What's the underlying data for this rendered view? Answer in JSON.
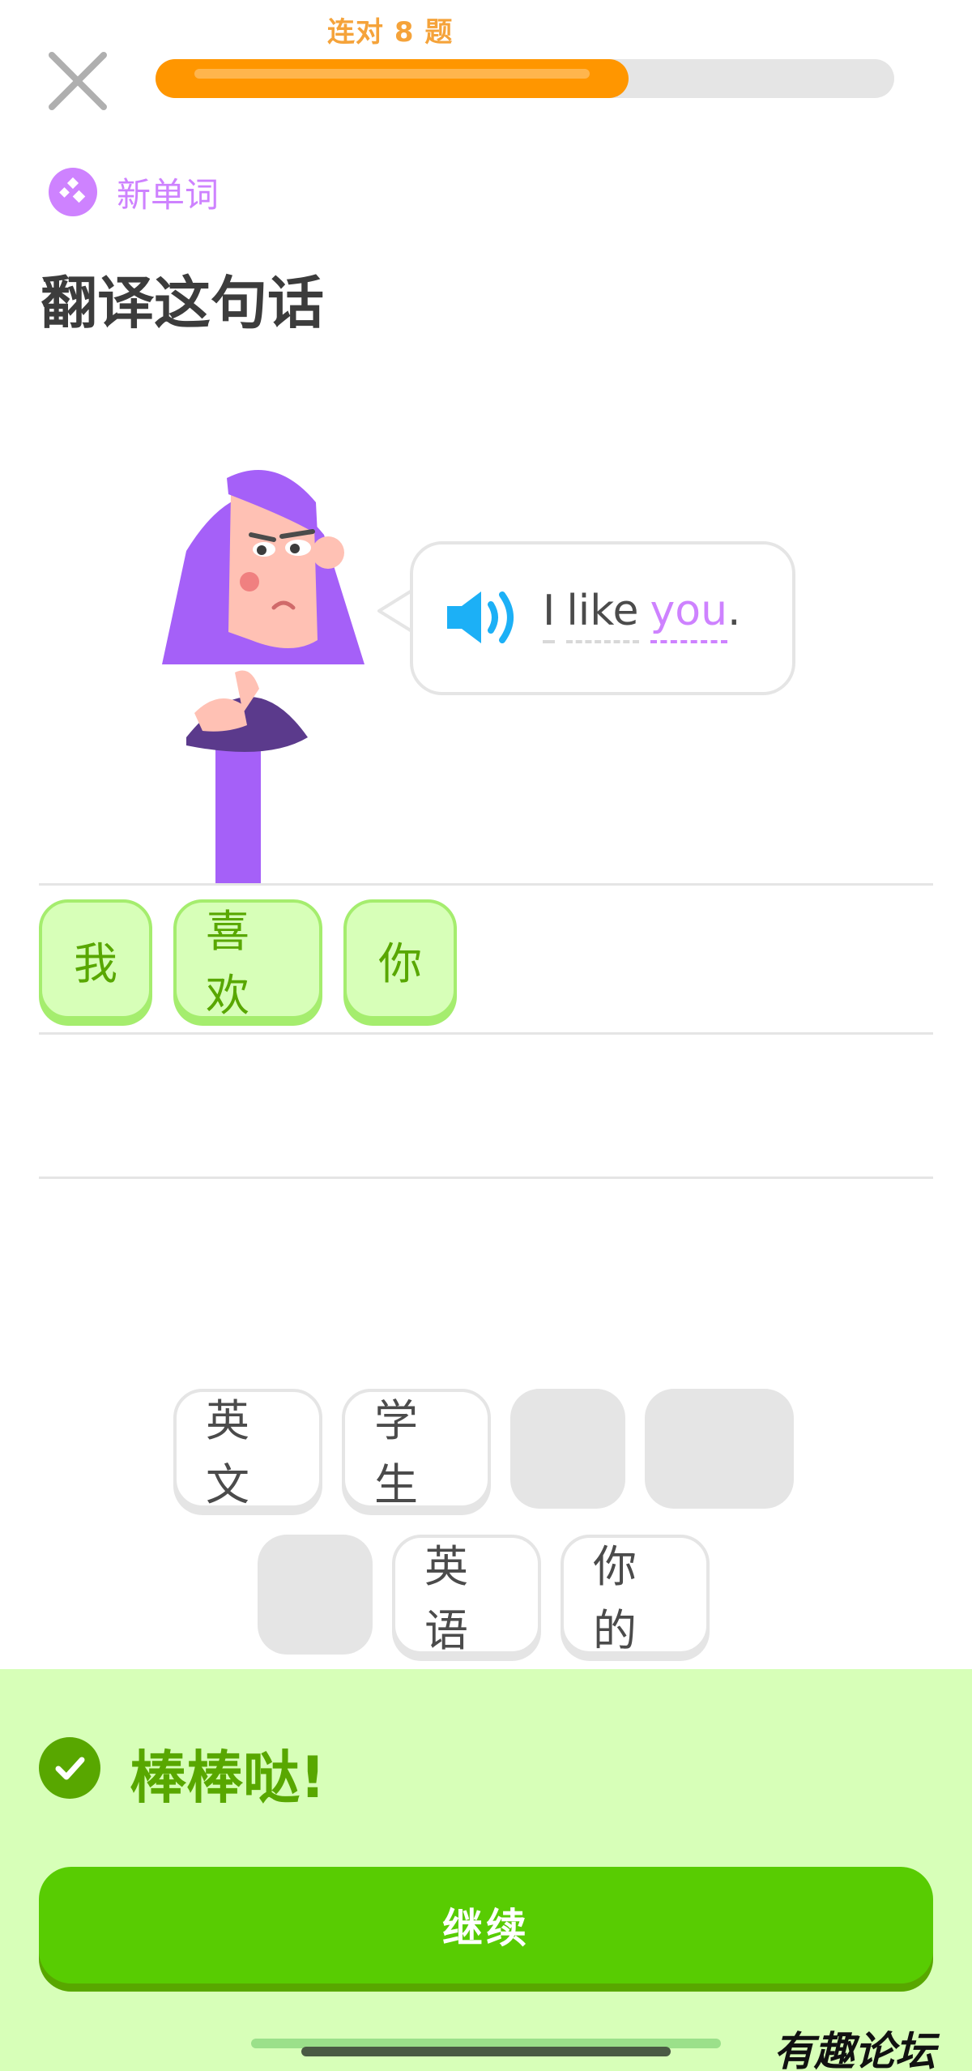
{
  "header": {
    "streak_label": "连对 8 题",
    "progress": 0.64,
    "close_icon": "close-icon"
  },
  "badge": {
    "icon": "new-word-icon",
    "label": "新单词"
  },
  "prompt": {
    "title": "翻译这句话",
    "speaker_icon": "speaker-icon",
    "sentence": {
      "words": [
        "I",
        "like"
      ],
      "highlight": "you",
      "punctuation": "."
    }
  },
  "answer": {
    "chips": [
      "我",
      "喜欢",
      "你"
    ]
  },
  "word_bank": {
    "row1": [
      "英文",
      "学生",
      "",
      ""
    ],
    "row2": [
      "",
      "英语",
      "你的"
    ]
  },
  "feedback": {
    "icon": "check-icon",
    "message": "棒棒哒!",
    "continue_label": "继续"
  },
  "watermark": "有趣论坛",
  "colors": {
    "accent_orange": "#ff9600",
    "purple": "#ce82ff",
    "success_green": "#58cc02",
    "success_dark": "#58a700",
    "success_bg": "#d7ffb8",
    "speaker_blue": "#1cb0f6"
  }
}
